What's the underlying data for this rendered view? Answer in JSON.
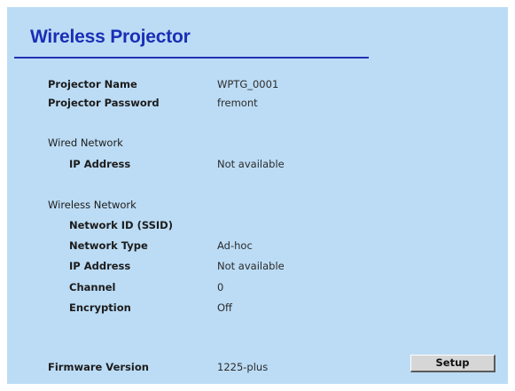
{
  "title": "Wireless Projector",
  "projector": {
    "name_label": "Projector Name",
    "name_value": "WPTG_0001",
    "password_label": "Projector Password",
    "password_value": "fremont"
  },
  "wired": {
    "heading": "Wired Network",
    "ip_label": "IP Address",
    "ip_value": "Not available"
  },
  "wireless": {
    "heading": "Wireless Network",
    "ssid_label": "Network ID (SSID)",
    "ssid_value": "",
    "type_label": "Network Type",
    "type_value": "Ad-hoc",
    "ip_label": "IP Address",
    "ip_value": "Not available",
    "channel_label": "Channel",
    "channel_value": "0",
    "encryption_label": "Encryption",
    "encryption_value": "Off"
  },
  "firmware": {
    "label": "Firmware Version",
    "value": "1225-plus"
  },
  "buttons": {
    "setup": "Setup"
  },
  "colors": {
    "background": "#bcdcf5",
    "title": "#1a2fb5",
    "rule": "#2432b8"
  }
}
